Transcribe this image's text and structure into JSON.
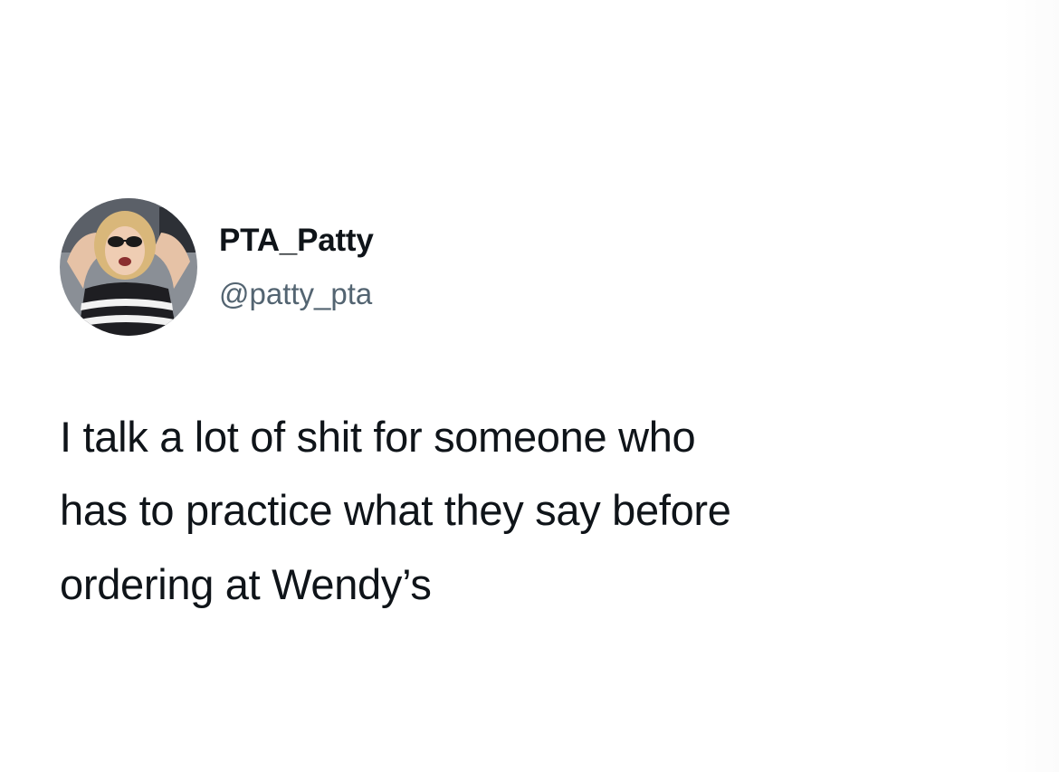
{
  "tweet": {
    "avatar_icon": "user-avatar-photo",
    "display_name": "PTA_Patty",
    "handle": "@patty_pta",
    "text_lines": [
      "I talk a lot of shit for someone who",
      "has to practice what they say before",
      "ordering at Wendy’s"
    ]
  },
  "colors": {
    "background": "#ffffff",
    "text_primary": "#0f1419",
    "text_secondary": "#536471"
  }
}
